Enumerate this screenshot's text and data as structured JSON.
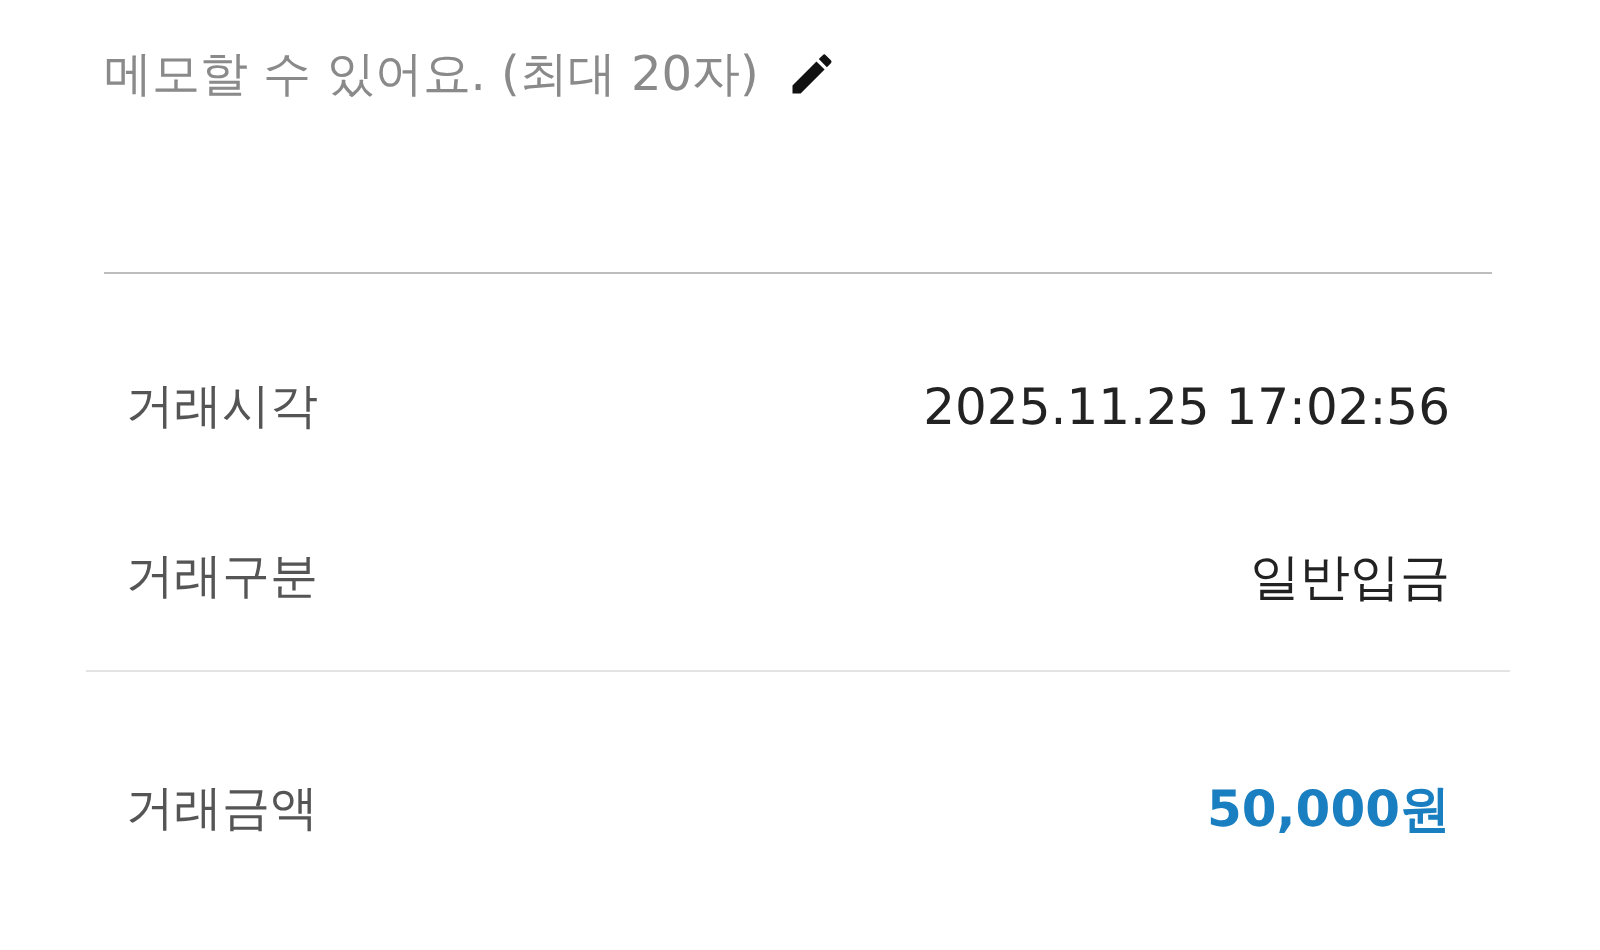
{
  "memo": {
    "hint": "메모할 수 있어요. (최대 20자)"
  },
  "details": [
    {
      "label": "거래시각",
      "value": "2025.11.25 17:02:56",
      "kind": "plain"
    },
    {
      "label": "거래구분",
      "value": "일반입금",
      "kind": "plain"
    }
  ],
  "total": {
    "label": "거래금액",
    "value": "50,000원",
    "kind": "amount"
  }
}
